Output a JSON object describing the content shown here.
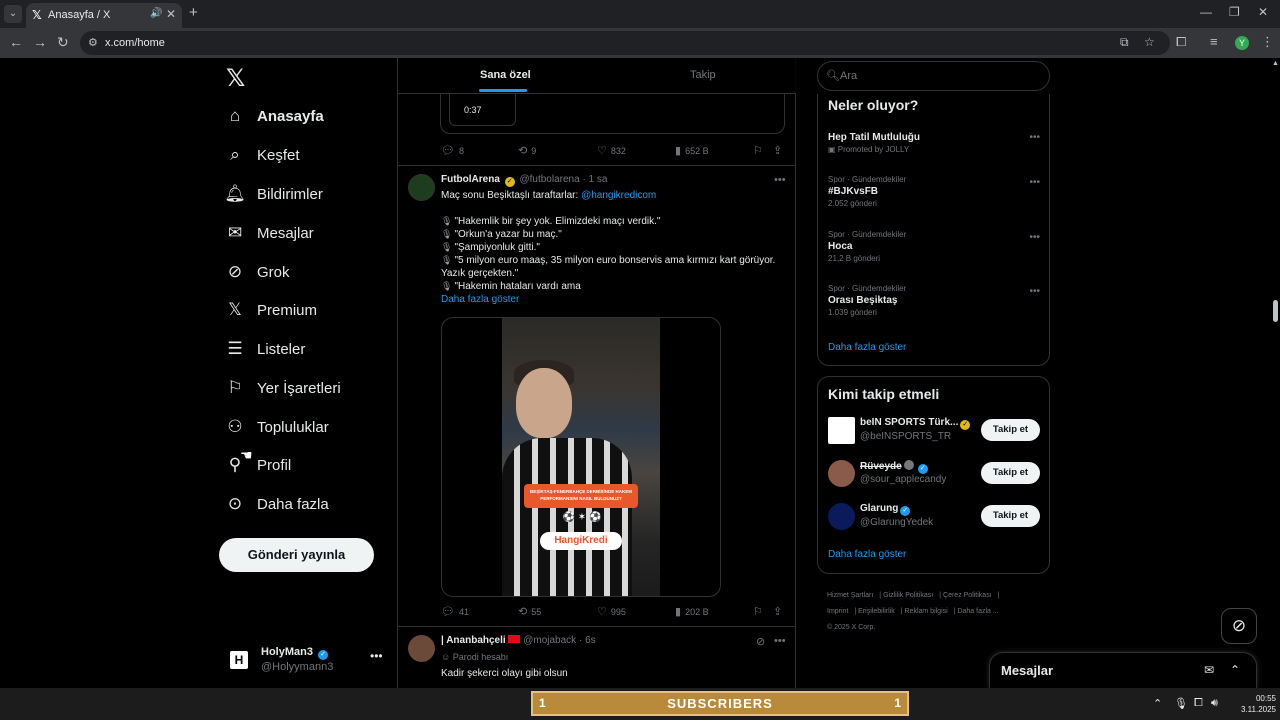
{
  "browser": {
    "tab_title": "Anasayfa / X",
    "url": "x.com/home"
  },
  "nav": {
    "items": [
      {
        "label": "Anasayfa",
        "icon": "home-icon",
        "active": true
      },
      {
        "label": "Keşfet",
        "icon": "search-icon"
      },
      {
        "label": "Bildirimler",
        "icon": "bell-icon"
      },
      {
        "label": "Mesajlar",
        "icon": "mail-icon"
      },
      {
        "label": "Grok",
        "icon": "grok-icon"
      },
      {
        "label": "Premium",
        "icon": "x-icon"
      },
      {
        "label": "Listeler",
        "icon": "list-icon"
      },
      {
        "label": "Yer İşaretleri",
        "icon": "bookmark-icon"
      },
      {
        "label": "Topluluklar",
        "icon": "people-icon"
      },
      {
        "label": "Profil",
        "icon": "person-icon"
      },
      {
        "label": "Daha fazla",
        "icon": "more-circle-icon"
      }
    ],
    "post_button": "Gönderi yayınla",
    "account": {
      "name": "HolyMan3",
      "handle": "@Holyymann3"
    }
  },
  "feed": {
    "tabs": [
      "Sana özel",
      "Takip"
    ],
    "previous_post": {
      "video_time": "0:37",
      "replies": "8",
      "reposts": "9",
      "likes": "832",
      "views": "652 B"
    },
    "post": {
      "author": "FutbolArena",
      "handle": "@futbolarena",
      "time": "· 1 sa",
      "intro": "Maç sonu Beşiktaşlı taraftarlar:",
      "mention": "@hangikredicom",
      "lines": [
        "\"Hakemlik bir şey yok. Elimizdeki maçı verdik.\"",
        "\"Orkun'a yazar bu maç.\"",
        "\"Şampiyonluk gitti.\"",
        "\"5 milyon euro maaş, 35 milyon euro bonservis ama kırmızı kart görüyor. Yazık gerçekten.\"",
        "\"Hakemin hataları vardı ama"
      ],
      "show_more": "Daha fazla göster",
      "video_banner": "BEŞİKTAŞ-FENERBAHÇE DERBİSİNDE HAKEM PERFORMANSINI NASIL BULDUNUZ?",
      "video_brand": "HangiKredi",
      "replies": "41",
      "reposts": "55",
      "likes": "995",
      "views": "202 B"
    },
    "next_post": {
      "author": "| Ananbahçeli",
      "handle": "@mojaback",
      "time": "· 6s",
      "badge": "Parodi hesabı",
      "text": "Kadir şekerci olayı gibi olsun"
    }
  },
  "right": {
    "search_placeholder": "Ara",
    "trends_title": "Neler oluyor?",
    "trends": [
      {
        "context": "",
        "title": "Hep Tatil Mutluluğu",
        "count": "Promoted by JOLLY"
      },
      {
        "context": "Spor · Gündemdekiler",
        "title": "#BJKvsFB",
        "count": "2.052 gönderi"
      },
      {
        "context": "Spor · Gündemdekiler",
        "title": "Hoca",
        "count": "21,2 B gönderi"
      },
      {
        "context": "Spor · Gündemdekiler",
        "title": "Orası Beşiktaş",
        "count": "1.039 gönderi"
      }
    ],
    "trends_more": "Daha fazla göster",
    "who_title": "Kimi takip etmeli",
    "who": [
      {
        "name": "beIN SPORTS Türk...",
        "handle": "@beINSPORTS_TR",
        "badge": "gold"
      },
      {
        "name": "Rüveyde",
        "handle": "@sour_applecandy",
        "badge": "blue"
      },
      {
        "name": "Glarung",
        "handle": "@GlarungYedek",
        "badge": "blue"
      }
    ],
    "follow_label": "Takip et",
    "who_more": "Daha fazla göster",
    "footer": [
      "Hizmet Şartları",
      "Gizlilik Politikası",
      "Çerez Politikası",
      "Imprint",
      "Erişilebilirlik",
      "Reklam bilgisi",
      "Daha fazla ...",
      "© 2025 X Corp."
    ]
  },
  "messages_drawer": {
    "title": "Mesajlar"
  },
  "taskbar": {
    "overlay_left": "1",
    "overlay_label": "SUBSCRIBERS",
    "overlay_right": "1",
    "time": "00:55",
    "date": "3.11.2025"
  },
  "colors": {
    "accent": "#1d9bf0",
    "background": "#000000",
    "border": "#2f3336",
    "muted": "#71767b"
  }
}
